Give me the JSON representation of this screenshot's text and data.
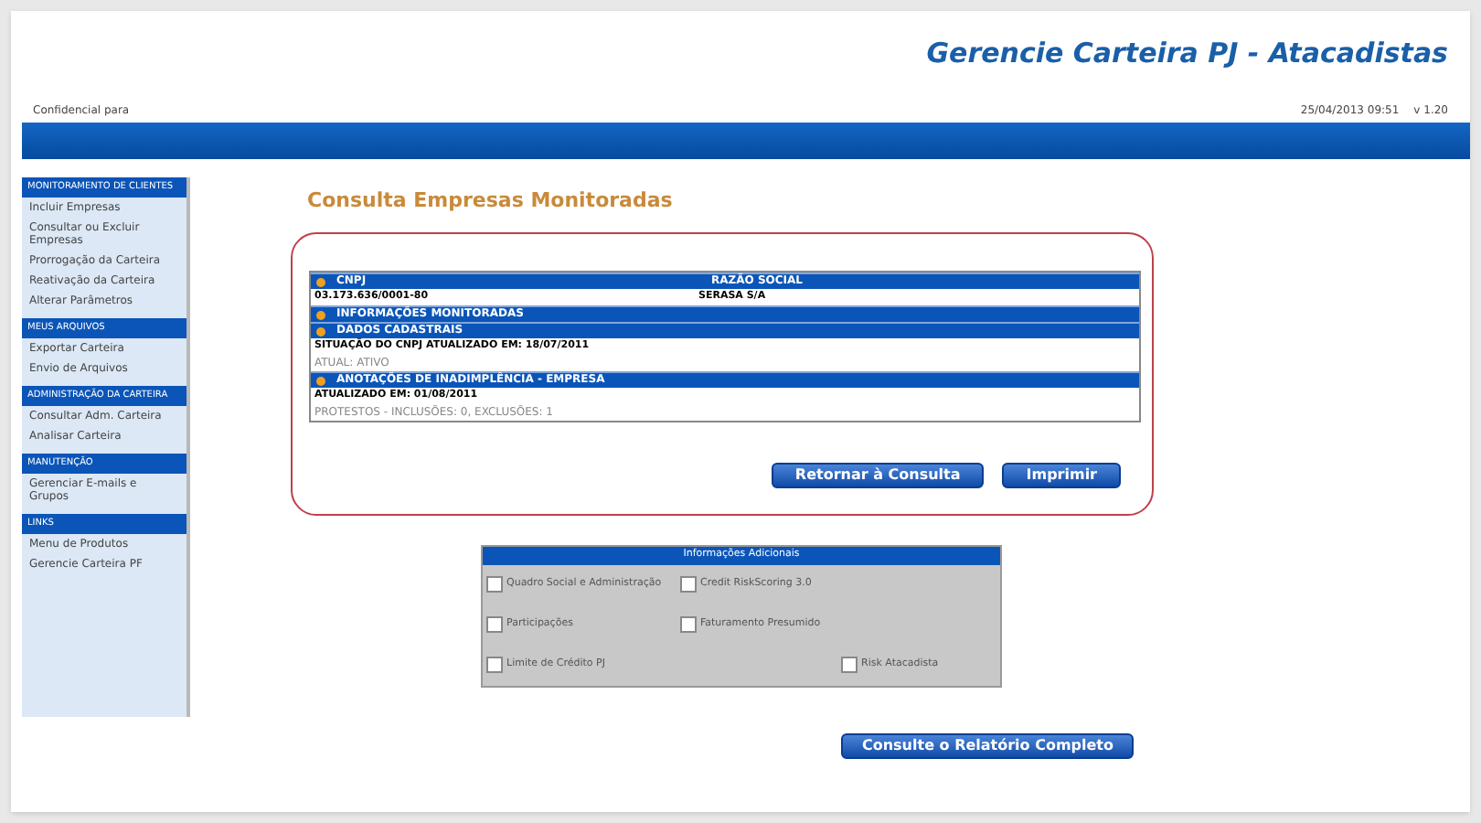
{
  "header": {
    "title": "Gerencie Carteira PJ - Atacadistas",
    "confidential": "Confidencial para",
    "datetime": "25/04/2013 09:51",
    "version": "v 1.20"
  },
  "sidebar": {
    "sections": [
      {
        "title": "MONITORAMENTO DE CLIENTES",
        "items": [
          "Incluir Empresas",
          "Consultar ou Excluir Empresas",
          "Prorrogação da Carteira",
          "Reativação da Carteira",
          "Alterar Parâmetros"
        ]
      },
      {
        "title": "MEUS ARQUIVOS",
        "items": [
          "Exportar Carteira",
          "Envio de Arquivos"
        ]
      },
      {
        "title": "ADMINISTRAÇÃO DA CARTEIRA",
        "items": [
          "Consultar Adm. Carteira",
          "Analisar Carteira"
        ]
      },
      {
        "title": "MANUTENÇÃO",
        "items": [
          "Gerenciar E-mails e Grupos"
        ]
      },
      {
        "title": "LINKS",
        "items": [
          "Menu de Produtos",
          "Gerencie Carteira PF"
        ]
      }
    ]
  },
  "page_title": "Consulta Empresas Monitoradas",
  "table": {
    "rows": [
      {
        "kind": "header",
        "cells": [
          "CNPJ",
          "RAZÃO SOCIAL"
        ]
      },
      {
        "kind": "data",
        "cells": [
          "03.173.636/0001-80",
          "SERASA S/A"
        ]
      },
      {
        "kind": "header",
        "cells": [
          "INFORMAÇÕES MONITORADAS"
        ]
      },
      {
        "kind": "header",
        "cells": [
          "DADOS CADASTRAIS"
        ]
      },
      {
        "kind": "data",
        "cells": [
          "SITUAÇÃO DO CNPJ ATUALIZADO EM: 18/07/2011"
        ]
      },
      {
        "kind": "note",
        "cells": [
          "ATUAL: ATIVO"
        ]
      },
      {
        "kind": "header",
        "cells": [
          "ANOTAÇÕES DE INADIMPLÊNCIA - EMPRESA"
        ]
      },
      {
        "kind": "data",
        "cells": [
          "ATUALIZADO EM: 01/08/2011"
        ]
      },
      {
        "kind": "note",
        "cells": [
          "PROTESTOS - INCLUSÕES: 0, EXCLUSÕES: 1"
        ]
      }
    ]
  },
  "actions": [
    "Retornar à Consulta",
    "Imprimir"
  ],
  "additional": {
    "title": "Informações Adicionais",
    "rows": [
      [
        {
          "label": "Quadro Social e Administração",
          "checked": false
        },
        {
          "label": "Credit RiskScoring 3.0",
          "checked": false
        }
      ],
      [
        {
          "label": "Participações",
          "checked": false
        },
        {
          "label": "Faturamento Presumido",
          "checked": false
        }
      ],
      [
        {
          "label": "Limite de Crédito PJ",
          "checked": false
        },
        {
          "label": "Risk Atacadista",
          "checked": false
        }
      ]
    ]
  },
  "full_report_button": "Consulte o Relatório Completo"
}
